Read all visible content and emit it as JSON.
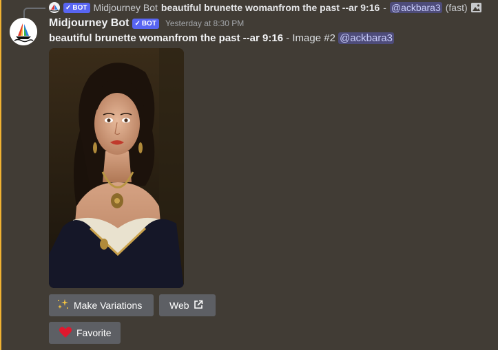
{
  "reply": {
    "bot_badge": "BOT",
    "author": "Midjourney Bot",
    "prompt": "beautiful brunette womanfrom the past --ar 9:16",
    "separator": "-",
    "mention": "@ackbara3",
    "speed": "(fast)"
  },
  "message": {
    "author": "Midjourney Bot",
    "bot_badge": "BOT",
    "timestamp": "Yesterday at 8:30 PM",
    "prompt": "beautiful brunette womanfrom the past --ar 9:16",
    "suffix": " - Image #2 ",
    "mention": "@ackbara3"
  },
  "buttons": {
    "make_variations": "Make Variations",
    "web": "Web",
    "favorite": "Favorite"
  },
  "colors": {
    "background": "#413c35",
    "bot_badge": "#5865f2",
    "button": "#5d5f64",
    "accent_bar": "#f0b232",
    "heart": "#e0182e"
  }
}
